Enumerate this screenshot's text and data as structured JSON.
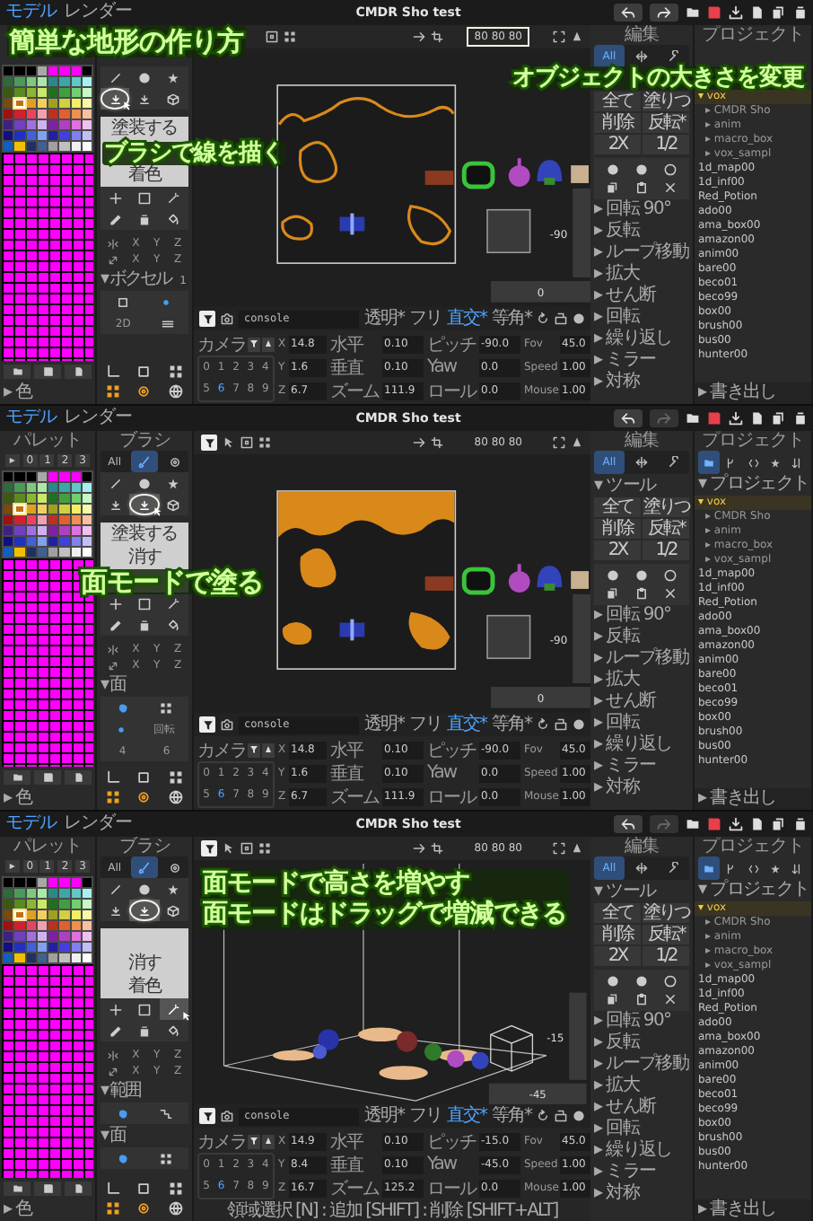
{
  "palette_colors": [
    {
      "color": "#000000",
      "selected": false
    },
    {
      "color": "#000000",
      "selected": false
    },
    {
      "color": "#000000",
      "selected": false
    },
    {
      "color": "#a8a8a8",
      "selected": false
    },
    {
      "color": "#ff00ff",
      "selected": false
    },
    {
      "color": "#ff00ff",
      "selected": false
    },
    {
      "color": "#ff00ff",
      "selected": false
    },
    {
      "color": "#000000",
      "selected": false
    },
    {
      "color": "#2e6b3a",
      "selected": false
    },
    {
      "color": "#4a9a5a",
      "selected": false
    },
    {
      "color": "#7acb7a",
      "selected": false
    },
    {
      "color": "#a8e8a8",
      "selected": false
    },
    {
      "color": "#2a8a8a",
      "selected": false
    },
    {
      "color": "#3aa8a8",
      "selected": false
    },
    {
      "color": "#60c8c8",
      "selected": false
    },
    {
      "color": "#a8f0f0",
      "selected": false
    },
    {
      "color": "#3a5a10",
      "selected": false
    },
    {
      "color": "#5a8a20",
      "selected": false
    },
    {
      "color": "#8ab830",
      "selected": false
    },
    {
      "color": "#c8e868",
      "selected": false
    },
    {
      "color": "#207020",
      "selected": false
    },
    {
      "color": "#40a040",
      "selected": false
    },
    {
      "color": "#70d070",
      "selected": false
    },
    {
      "color": "#c8f8c8",
      "selected": false
    },
    {
      "color": "#7a4a10",
      "selected": false
    },
    {
      "color": "#c07010",
      "selected": true
    },
    {
      "color": "#e0a020",
      "selected": false
    },
    {
      "color": "#f0d060",
      "selected": false
    },
    {
      "color": "#a0a020",
      "selected": false
    },
    {
      "color": "#d0d040",
      "selected": false
    },
    {
      "color": "#f0f060",
      "selected": false
    },
    {
      "color": "#f8f8a8",
      "selected": false
    },
    {
      "color": "#a01010",
      "selected": false
    },
    {
      "color": "#d02030",
      "selected": false
    },
    {
      "color": "#f04060",
      "selected": false
    },
    {
      "color": "#f0a0b0",
      "selected": false
    },
    {
      "color": "#c03020",
      "selected": false
    },
    {
      "color": "#e06030",
      "selected": false
    },
    {
      "color": "#f09050",
      "selected": false
    },
    {
      "color": "#f8c0a0",
      "selected": false
    },
    {
      "color": "#402080",
      "selected": false
    },
    {
      "color": "#7040c0",
      "selected": false
    },
    {
      "color": "#a070e0",
      "selected": false
    },
    {
      "color": "#d0b0f0",
      "selected": false
    },
    {
      "color": "#8020a0",
      "selected": false
    },
    {
      "color": "#b040c0",
      "selected": false
    },
    {
      "color": "#e070e0",
      "selected": false
    },
    {
      "color": "#f0c0f0",
      "selected": false
    },
    {
      "color": "#101080",
      "selected": false
    },
    {
      "color": "#2030c0",
      "selected": false
    },
    {
      "color": "#4060e0",
      "selected": false
    },
    {
      "color": "#80a0f0",
      "selected": false
    },
    {
      "color": "#2020a0",
      "selected": false
    },
    {
      "color": "#4040e0",
      "selected": false
    },
    {
      "color": "#8080f0",
      "selected": false
    },
    {
      "color": "#c0c0f8",
      "selected": false
    },
    {
      "color": "#1060c0",
      "selected": false
    },
    {
      "color": "#f0c000",
      "selected": false
    },
    {
      "color": "#203060",
      "selected": false
    },
    {
      "color": "#406090",
      "selected": false
    },
    {
      "color": "#a0a0a0",
      "selected": false
    },
    {
      "color": "#c0c0c0",
      "selected": false
    },
    {
      "color": "#f0f0f0",
      "selected": false
    },
    {
      "color": "#ffffff",
      "selected": false
    }
  ],
  "screens": [
    {
      "tabs": [
        {
          "label": "モデル",
          "selected": true
        },
        {
          "label": "レンダー",
          "selected": false
        }
      ],
      "title": "CMDR Sho test",
      "redo": {
        "disabled": false
      },
      "palette_footer": "▸ 色",
      "tools": [
        {
          "selected": false,
          "highlighted": false,
          "pointer": false
        },
        {
          "selected": false,
          "highlighted": false,
          "pointer": false
        },
        {
          "selected": false,
          "highlighted": false,
          "pointer": false
        },
        {
          "selected": true,
          "highlighted": true,
          "pointer": true
        },
        {
          "selected": false,
          "highlighted": false,
          "pointer": false
        },
        {
          "selected": false,
          "highlighted": false,
          "pointer": false
        },
        {
          "selected": false,
          "highlighted": false,
          "pointer": false
        },
        {
          "selected": false,
          "highlighted": false,
          "pointer": false
        },
        {
          "selected": false,
          "highlighted": false,
          "pointer": false
        },
        {
          "selected": false,
          "highlighted": false,
          "pointer": false
        },
        {
          "selected": false,
          "highlighted": false,
          "pointer": false
        },
        {
          "selected": false,
          "highlighted": false,
          "pointer": false
        }
      ],
      "menu": [
        {
          "kind": "item",
          "label": "塗装する"
        },
        {
          "kind": "covered"
        },
        {
          "kind": "item",
          "label": "着色"
        }
      ],
      "axis_rows": [
        [
          "X",
          "Y",
          "Z"
        ],
        [
          "X",
          "Y",
          "Z"
        ]
      ],
      "brush_sections": [
        {
          "label": "▾ ボクセル",
          "count": "1",
          "rows": [
            [
              {
                "kind": "square"
              },
              {
                "kind": "dot"
              }
            ],
            [
              {
                "kind": "text",
                "label": "2D"
              },
              {
                "kind": "bars"
              }
            ]
          ]
        }
      ],
      "size": {
        "text": "80 80 80",
        "highlighted": true
      },
      "view": {
        "kind": "outline",
        "vertical": "-90",
        "horizontal": "0"
      },
      "console": {
        "value": "console",
        "toggles": [
          {
            "label": "透明*",
            "selected": false
          },
          {
            "label": "フリ",
            "selected": false
          },
          {
            "label": "直交*",
            "selected": true
          },
          {
            "label": "等角*",
            "selected": false
          }
        ]
      },
      "camera": {
        "label": "カメラ",
        "digits": [
          {
            "label": "0",
            "selected": false
          },
          {
            "label": "1",
            "selected": false
          },
          {
            "label": "2",
            "selected": false
          },
          {
            "label": "3",
            "selected": false
          },
          {
            "label": "4",
            "selected": false
          },
          {
            "label": "5",
            "selected": false
          },
          {
            "label": "6",
            "selected": true
          },
          {
            "label": "7",
            "selected": false
          },
          {
            "label": "8",
            "selected": false
          },
          {
            "label": "9",
            "selected": false
          }
        ]
      },
      "field_groups": [
        [
          {
            "label": "X",
            "value": "14.8"
          },
          {
            "label": "Y",
            "value": "1.6"
          },
          {
            "label": "Z",
            "value": "6.7"
          }
        ],
        [
          {
            "label": "水平",
            "value": "0.10"
          },
          {
            "label": "垂直",
            "value": "0.10"
          },
          {
            "label": "ズーム",
            "value": "111.9"
          }
        ],
        [
          {
            "label": "ピッチ",
            "value": "-90.0"
          },
          {
            "label": "Yaw",
            "value": "0.0"
          },
          {
            "label": "ロール",
            "value": "0.0"
          }
        ],
        [
          {
            "label": "Fov",
            "value": "45.0"
          },
          {
            "label": "Speed",
            "value": "1.00"
          },
          {
            "label": "Mouse",
            "value": "1.00"
          }
        ]
      ],
      "edit": {
        "header": "編集",
        "tabs": [
          {
            "kind": "text",
            "label": "All",
            "selected": true
          },
          {
            "kind": "arrows",
            "selected": false
          },
          {
            "kind": "wrench",
            "selected": false
          }
        ],
        "buttons": [
          "全て",
          "塗りつ",
          "削除",
          "反転*",
          "2X",
          "1/2"
        ],
        "sections": [
          "▸ 回転 90°",
          "▸ 反転",
          "▸ ループ移動",
          "▸ 拡大",
          "▸ せん断",
          "▸ 回転",
          "▸ 繰り返し",
          "▸ ミラー",
          "▸ 対称"
        ]
      },
      "project": {
        "header": "プロジェクト",
        "tree": [
          {
            "label": "▾ vox",
            "selected": true,
            "children": [
              {
                "label": "▸ CMDR Sho",
                "selected": false
              },
              {
                "label": "▸ anim",
                "selected": false
              },
              {
                "label": "▸ macro_box",
                "selected": false
              },
              {
                "label": "▸ vox_sampl",
                "selected": false
              }
            ]
          },
          {
            "label": "1d_map00",
            "selected": false
          },
          {
            "label": "1d_inf00",
            "selected": false
          },
          {
            "label": "Red_Potion",
            "selected": false
          },
          {
            "label": "ado00",
            "selected": false
          },
          {
            "label": "ama_box00",
            "selected": false
          },
          {
            "label": "amazon00",
            "selected": false
          },
          {
            "label": "anim00",
            "selected": false
          },
          {
            "label": "bare00",
            "selected": false
          },
          {
            "label": "beco01",
            "selected": false
          },
          {
            "label": "beco99",
            "selected": false
          },
          {
            "label": "box00",
            "selected": false
          },
          {
            "label": "brush00",
            "selected": false
          },
          {
            "label": "bus00",
            "selected": false
          },
          {
            "label": "hunter00",
            "selected": false
          }
        ],
        "footer": "▸ 書き出し"
      },
      "annotations": [
        {
          "kind": "title",
          "lines": [
            "簡単な地形の作り方"
          ]
        },
        {
          "kind": "brush-note",
          "lines": [
            "ブラシで線を描く"
          ]
        },
        {
          "kind": "size-note",
          "lines": [
            "オブジェクトの大きさを変更"
          ]
        }
      ]
    },
    {
      "tabs": [
        {
          "label": "モデル",
          "selected": true
        },
        {
          "label": "レンダー",
          "selected": false
        }
      ],
      "title": "CMDR Sho test",
      "redo": {
        "disabled": true
      },
      "palette_header": "パレット",
      "palette_tabs": [
        "▸",
        "0",
        "1",
        "2",
        "3"
      ],
      "palette_footer": "▸ 色",
      "brush_header": "ブラシ",
      "brush_tabs": [
        {
          "kind": "text",
          "label": "All",
          "selected": false
        },
        {
          "kind": "brush",
          "selected": true
        },
        {
          "kind": "gear",
          "selected": false
        }
      ],
      "tools": [
        {
          "selected": false,
          "highlighted": false,
          "pointer": false
        },
        {
          "selected": false,
          "highlighted": false,
          "pointer": false
        },
        {
          "selected": false,
          "highlighted": false,
          "pointer": false
        },
        {
          "selected": false,
          "highlighted": false,
          "pointer": false
        },
        {
          "selected": true,
          "highlighted": true,
          "pointer": true
        },
        {
          "selected": false,
          "highlighted": false,
          "pointer": false
        },
        {
          "selected": false,
          "highlighted": false,
          "pointer": false
        },
        {
          "selected": false,
          "highlighted": false,
          "pointer": false
        },
        {
          "selected": false,
          "highlighted": false,
          "pointer": false
        },
        {
          "selected": false,
          "highlighted": false,
          "pointer": false
        },
        {
          "selected": false,
          "highlighted": false,
          "pointer": false
        },
        {
          "selected": false,
          "highlighted": false,
          "pointer": false
        }
      ],
      "menu": [
        {
          "kind": "item",
          "label": "塗装する"
        },
        {
          "kind": "item",
          "label": "消す"
        },
        {
          "kind": "covered"
        }
      ],
      "axis_rows": [
        [
          "X",
          "Y",
          "Z"
        ],
        [
          "X",
          "Y",
          "Z"
        ]
      ],
      "brush_sections": [
        {
          "label": "▾ 面",
          "rows": [
            [
              {
                "kind": "blob"
              },
              {
                "kind": "grid"
              }
            ],
            [
              {
                "kind": "dot"
              },
              {
                "kind": "text",
                "label": "回転"
              }
            ],
            [
              {
                "kind": "text",
                "label": "4"
              },
              {
                "kind": "text",
                "label": "6"
              }
            ]
          ]
        }
      ],
      "size": {
        "text": "80 80 80",
        "highlighted": false
      },
      "view": {
        "kind": "filled",
        "vertical": "-90",
        "horizontal": "0"
      },
      "console": {
        "value": "console",
        "toggles": [
          {
            "label": "透明*",
            "selected": false
          },
          {
            "label": "フリ",
            "selected": false
          },
          {
            "label": "直交*",
            "selected": true
          },
          {
            "label": "等角*",
            "selected": false
          }
        ]
      },
      "camera": {
        "label": "カメラ",
        "digits": [
          {
            "label": "0",
            "selected": false
          },
          {
            "label": "1",
            "selected": false
          },
          {
            "label": "2",
            "selected": false
          },
          {
            "label": "3",
            "selected": false
          },
          {
            "label": "4",
            "selected": false
          },
          {
            "label": "5",
            "selected": false
          },
          {
            "label": "6",
            "selected": true
          },
          {
            "label": "7",
            "selected": false
          },
          {
            "label": "8",
            "selected": false
          },
          {
            "label": "9",
            "selected": false
          }
        ]
      },
      "field_groups": [
        [
          {
            "label": "X",
            "value": "14.8"
          },
          {
            "label": "Y",
            "value": "1.6"
          },
          {
            "label": "Z",
            "value": "6.7"
          }
        ],
        [
          {
            "label": "水平",
            "value": "0.10"
          },
          {
            "label": "垂直",
            "value": "0.10"
          },
          {
            "label": "ズーム",
            "value": "111.9"
          }
        ],
        [
          {
            "label": "ピッチ",
            "value": "-90.0"
          },
          {
            "label": "Yaw",
            "value": "0.0"
          },
          {
            "label": "ロール",
            "value": "0.0"
          }
        ],
        [
          {
            "label": "Fov",
            "value": "45.0"
          },
          {
            "label": "Speed",
            "value": "1.00"
          },
          {
            "label": "Mouse",
            "value": "1.00"
          }
        ]
      ],
      "edit": {
        "header": "編集",
        "tabs": [
          {
            "kind": "text",
            "label": "All",
            "selected": true
          },
          {
            "kind": "arrows",
            "selected": false
          },
          {
            "kind": "wrench",
            "selected": false
          }
        ],
        "tool_header": "▾ ツール",
        "buttons": [
          "全て",
          "塗りつ",
          "削除",
          "反転*",
          "2X",
          "1/2"
        ],
        "sections": [
          "▸ 回転 90°",
          "▸ 反転",
          "▸ ループ移動",
          "▸ 拡大",
          "▸ せん断",
          "▸ 回転",
          "▸ 繰り返し",
          "▸ ミラー",
          "▸ 対称"
        ]
      },
      "project": {
        "header": "プロジェクト",
        "tabs": [
          {
            "kind": "folder",
            "selected": true
          },
          {
            "kind": "branch",
            "selected": false
          },
          {
            "kind": "code",
            "selected": false
          },
          {
            "kind": "star",
            "selected": false
          },
          {
            "kind": "sort",
            "selected": false
          }
        ],
        "root": "▾ プロジェクト",
        "tree": [
          {
            "label": "▾ vox",
            "selected": true,
            "children": [
              {
                "label": "▸ CMDR Sho",
                "selected": false
              },
              {
                "label": "▸ anim",
                "selected": false
              },
              {
                "label": "▸ macro_box",
                "selected": false
              },
              {
                "label": "▸ vox_sampl",
                "selected": false
              }
            ]
          },
          {
            "label": "1d_map00",
            "selected": false
          },
          {
            "label": "1d_inf00",
            "selected": false
          },
          {
            "label": "Red_Potion",
            "selected": false
          },
          {
            "label": "ado00",
            "selected": false
          },
          {
            "label": "ama_box00",
            "selected": false
          },
          {
            "label": "amazon00",
            "selected": false
          },
          {
            "label": "anim00",
            "selected": false
          },
          {
            "label": "bare00",
            "selected": false
          },
          {
            "label": "beco01",
            "selected": false
          },
          {
            "label": "beco99",
            "selected": false
          },
          {
            "label": "box00",
            "selected": false
          },
          {
            "label": "brush00",
            "selected": false
          },
          {
            "label": "bus00",
            "selected": false
          },
          {
            "label": "hunter00",
            "selected": false
          }
        ],
        "footer": "▸ 書き出し"
      },
      "annotations": [
        {
          "kind": "paint-note",
          "lines": [
            "面モードで塗る"
          ]
        }
      ]
    },
    {
      "tabs": [
        {
          "label": "モデル",
          "selected": true
        },
        {
          "label": "レンダー",
          "selected": false
        }
      ],
      "title": "CMDR Sho test",
      "redo": {
        "disabled": true
      },
      "palette_header": "パレット",
      "palette_tabs": [
        "▸",
        "0",
        "1",
        "2",
        "3"
      ],
      "palette_footer": "▸ 色",
      "brush_header": "ブラシ",
      "brush_tabs": [
        {
          "kind": "text",
          "label": "All",
          "selected": false
        },
        {
          "kind": "brush",
          "selected": true
        },
        {
          "kind": "gear",
          "selected": false
        }
      ],
      "tools": [
        {
          "selected": false,
          "highlighted": false,
          "pointer": false
        },
        {
          "selected": false,
          "highlighted": false,
          "pointer": false
        },
        {
          "selected": false,
          "highlighted": false,
          "pointer": false
        },
        {
          "selected": false,
          "highlighted": false,
          "pointer": false
        },
        {
          "selected": true,
          "highlighted": true,
          "pointer": false
        },
        {
          "selected": false,
          "highlighted": false,
          "pointer": false
        },
        {
          "selected": false,
          "highlighted": false,
          "pointer": false
        },
        {
          "selected": false,
          "highlighted": false,
          "pointer": false
        },
        {
          "selected": true,
          "highlighted": false,
          "pointer": true
        },
        {
          "selected": false,
          "highlighted": false,
          "pointer": false
        },
        {
          "selected": false,
          "highlighted": false,
          "pointer": false
        },
        {
          "selected": false,
          "highlighted": false,
          "pointer": false
        }
      ],
      "menu": [
        {
          "kind": "covered"
        },
        {
          "kind": "item",
          "label": "消す"
        },
        {
          "kind": "item",
          "label": "着色"
        }
      ],
      "axis_rows": [
        [
          "X",
          "Y",
          "Z"
        ],
        [
          "X",
          "Y",
          "Z"
        ]
      ],
      "brush_sections": [
        {
          "label": "▾ 範囲",
          "rows": [
            [
              {
                "kind": "blob"
              },
              {
                "kind": "steps"
              }
            ]
          ]
        },
        {
          "label": "▾ 面",
          "rows": [
            [
              {
                "kind": "blob"
              },
              {
                "kind": "grid"
              }
            ]
          ]
        }
      ],
      "size": {
        "text": "80 80 80",
        "highlighted": false
      },
      "view": {
        "kind": "perspective",
        "vertical": "-15",
        "horizontal": "-45"
      },
      "console": {
        "value": "console",
        "toggles": [
          {
            "label": "透明*",
            "selected": false
          },
          {
            "label": "フリ",
            "selected": false
          },
          {
            "label": "直交*",
            "selected": true
          },
          {
            "label": "等角*",
            "selected": false
          }
        ]
      },
      "camera": {
        "label": "カメラ",
        "digits": [
          {
            "label": "0",
            "selected": false
          },
          {
            "label": "1",
            "selected": false
          },
          {
            "label": "2",
            "selected": false
          },
          {
            "label": "3",
            "selected": false
          },
          {
            "label": "4",
            "selected": false
          },
          {
            "label": "5",
            "selected": false
          },
          {
            "label": "6",
            "selected": true
          },
          {
            "label": "7",
            "selected": false
          },
          {
            "label": "8",
            "selected": false
          },
          {
            "label": "9",
            "selected": false
          }
        ]
      },
      "field_groups": [
        [
          {
            "label": "X",
            "value": "14.9"
          },
          {
            "label": "Y",
            "value": "8.4"
          },
          {
            "label": "Z",
            "value": "16.7"
          }
        ],
        [
          {
            "label": "水平",
            "value": "0.10"
          },
          {
            "label": "垂直",
            "value": "0.10"
          },
          {
            "label": "ズーム",
            "value": "125.2"
          }
        ],
        [
          {
            "label": "ピッチ",
            "value": "-15.0"
          },
          {
            "label": "Yaw",
            "value": "-45.0"
          },
          {
            "label": "ロール",
            "value": "0.0"
          }
        ],
        [
          {
            "label": "Fov",
            "value": "45.0"
          },
          {
            "label": "Speed",
            "value": "1.00"
          },
          {
            "label": "Mouse",
            "value": "1.00"
          }
        ]
      ],
      "status": "領域選択 [N] : 追加 [SHIFT] : 削除 [SHIFT+ALT]",
      "edit": {
        "header": "編集",
        "tabs": [
          {
            "kind": "text",
            "label": "All",
            "selected": true
          },
          {
            "kind": "arrows",
            "selected": false
          },
          {
            "kind": "wrench",
            "selected": false
          }
        ],
        "tool_header": "▾ ツール",
        "buttons": [
          "全て",
          "塗りつ",
          "削除",
          "反転*",
          "2X",
          "1/2"
        ],
        "sections": [
          "▸ 回転 90°",
          "▸ 反転",
          "▸ ループ移動",
          "▸ 拡大",
          "▸ せん断",
          "▸ 回転",
          "▸ 繰り返し",
          "▸ ミラー",
          "▸ 対称"
        ]
      },
      "project": {
        "header": "プロジェクト",
        "tabs": [
          {
            "kind": "folder",
            "selected": true
          },
          {
            "kind": "branch",
            "selected": false
          },
          {
            "kind": "code",
            "selected": false
          },
          {
            "kind": "star",
            "selected": false
          },
          {
            "kind": "sort",
            "selected": false
          }
        ],
        "root": "▾ プロジェクト",
        "tree": [
          {
            "label": "▾ vox",
            "selected": true,
            "children": [
              {
                "label": "▸ CMDR Sho",
                "selected": false
              },
              {
                "label": "▸ anim",
                "selected": false
              },
              {
                "label": "▸ macro_box",
                "selected": false
              },
              {
                "label": "▸ vox_sampl",
                "selected": false
              }
            ]
          },
          {
            "label": "1d_map00",
            "selected": false
          },
          {
            "label": "1d_inf00",
            "selected": false
          },
          {
            "label": "Red_Potion",
            "selected": false
          },
          {
            "label": "ado00",
            "selected": false
          },
          {
            "label": "ama_box00",
            "selected": false
          },
          {
            "label": "amazon00",
            "selected": false
          },
          {
            "label": "anim00",
            "selected": false
          },
          {
            "label": "bare00",
            "selected": false
          },
          {
            "label": "beco01",
            "selected": false
          },
          {
            "label": "beco99",
            "selected": false
          },
          {
            "label": "box00",
            "selected": false
          },
          {
            "label": "brush00",
            "selected": false
          },
          {
            "label": "bus00",
            "selected": false
          },
          {
            "label": "hunter00",
            "selected": false
          }
        ],
        "footer": "▸ 書き出し"
      },
      "annotations": [
        {
          "kind": "height-note",
          "lines": [
            "面モードで高さを増やす",
            "面モードはドラッグで増減できる"
          ]
        }
      ]
    }
  ]
}
